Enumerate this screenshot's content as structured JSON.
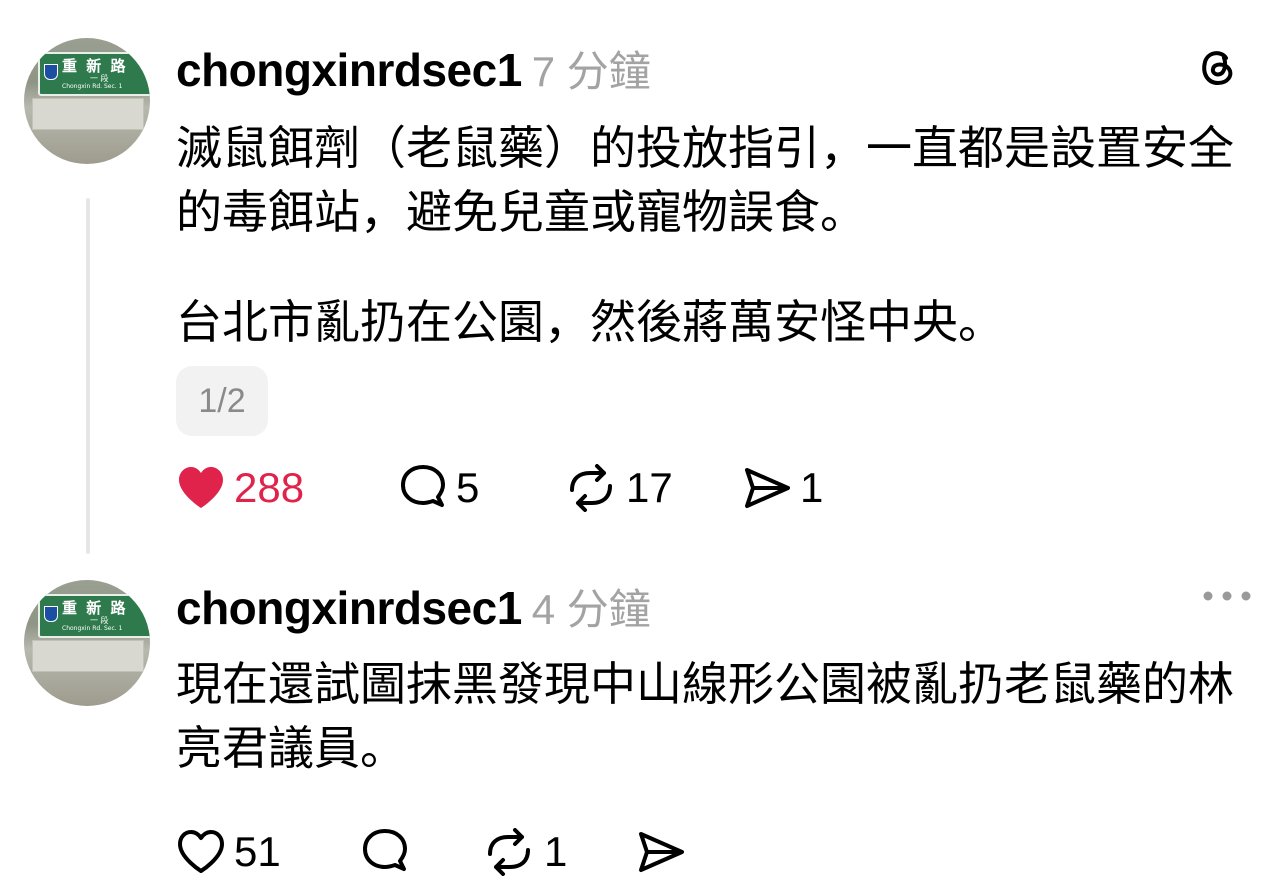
{
  "posts": [
    {
      "username": "chongxinrdsec1",
      "time": "7 分鐘",
      "paragraphs": [
        "滅鼠餌劑（老鼠藥）的投放指引，一直都是設置安全的毒餌站，避免兒童或寵物誤食。",
        "台北市亂扔在公園，然後蔣萬安怪中央。"
      ],
      "page_indicator": "1/2",
      "likes": "288",
      "liked": true,
      "replies": "5",
      "reposts": "17",
      "shares": "1"
    },
    {
      "username": "chongxinrdsec1",
      "time": "4 分鐘",
      "paragraphs": [
        "現在還試圖抹黑發現中山線形公園被亂扔老鼠藥的林亮君議員。"
      ],
      "likes": "51",
      "liked": false,
      "replies": "",
      "reposts": "1",
      "shares": ""
    }
  ],
  "avatar_sign": {
    "main": "重 新 路",
    "sub": "一 段",
    "en": "Chongxin Rd. Sec. 1"
  },
  "icons": {
    "app_logo": "threads-logo-icon",
    "more": "more-options-icon",
    "like": "heart-icon",
    "reply": "comment-icon",
    "repost": "repost-icon",
    "share": "share-icon"
  },
  "colors": {
    "like_active": "#e0234a",
    "muted_text": "#a3a3a3",
    "thread_line": "#e6e6e6"
  }
}
